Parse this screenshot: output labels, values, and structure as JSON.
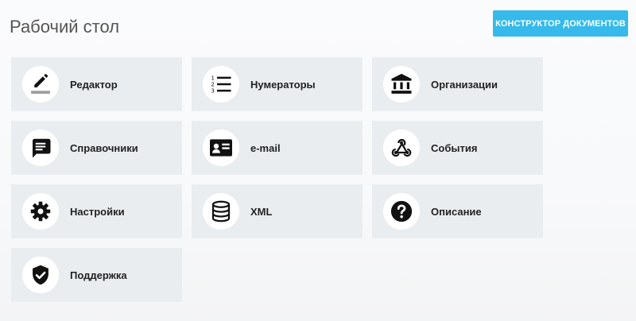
{
  "header": {
    "title": "Рабочий стол",
    "constructor_button": "КОНСТРУКТОР ДОКУМЕНТОВ"
  },
  "tiles": [
    {
      "label": "Редактор",
      "icon": "pencil-icon"
    },
    {
      "label": "Нумераторы",
      "icon": "numbered-list-icon"
    },
    {
      "label": "Организации",
      "icon": "bank-icon"
    },
    {
      "label": "Справочники",
      "icon": "message-icon"
    },
    {
      "label": "e-mail",
      "icon": "contact-card-icon"
    },
    {
      "label": "События",
      "icon": "webhook-icon"
    },
    {
      "label": "Настройки",
      "icon": "gear-icon"
    },
    {
      "label": "XML",
      "icon": "database-icon"
    },
    {
      "label": "Описание",
      "icon": "help-icon"
    },
    {
      "label": "Поддержка",
      "icon": "verified-shield-icon"
    }
  ],
  "colors": {
    "accent": "#36b9eb",
    "tile_background": "#eaedf0",
    "icon_circle": "#ffffff"
  }
}
